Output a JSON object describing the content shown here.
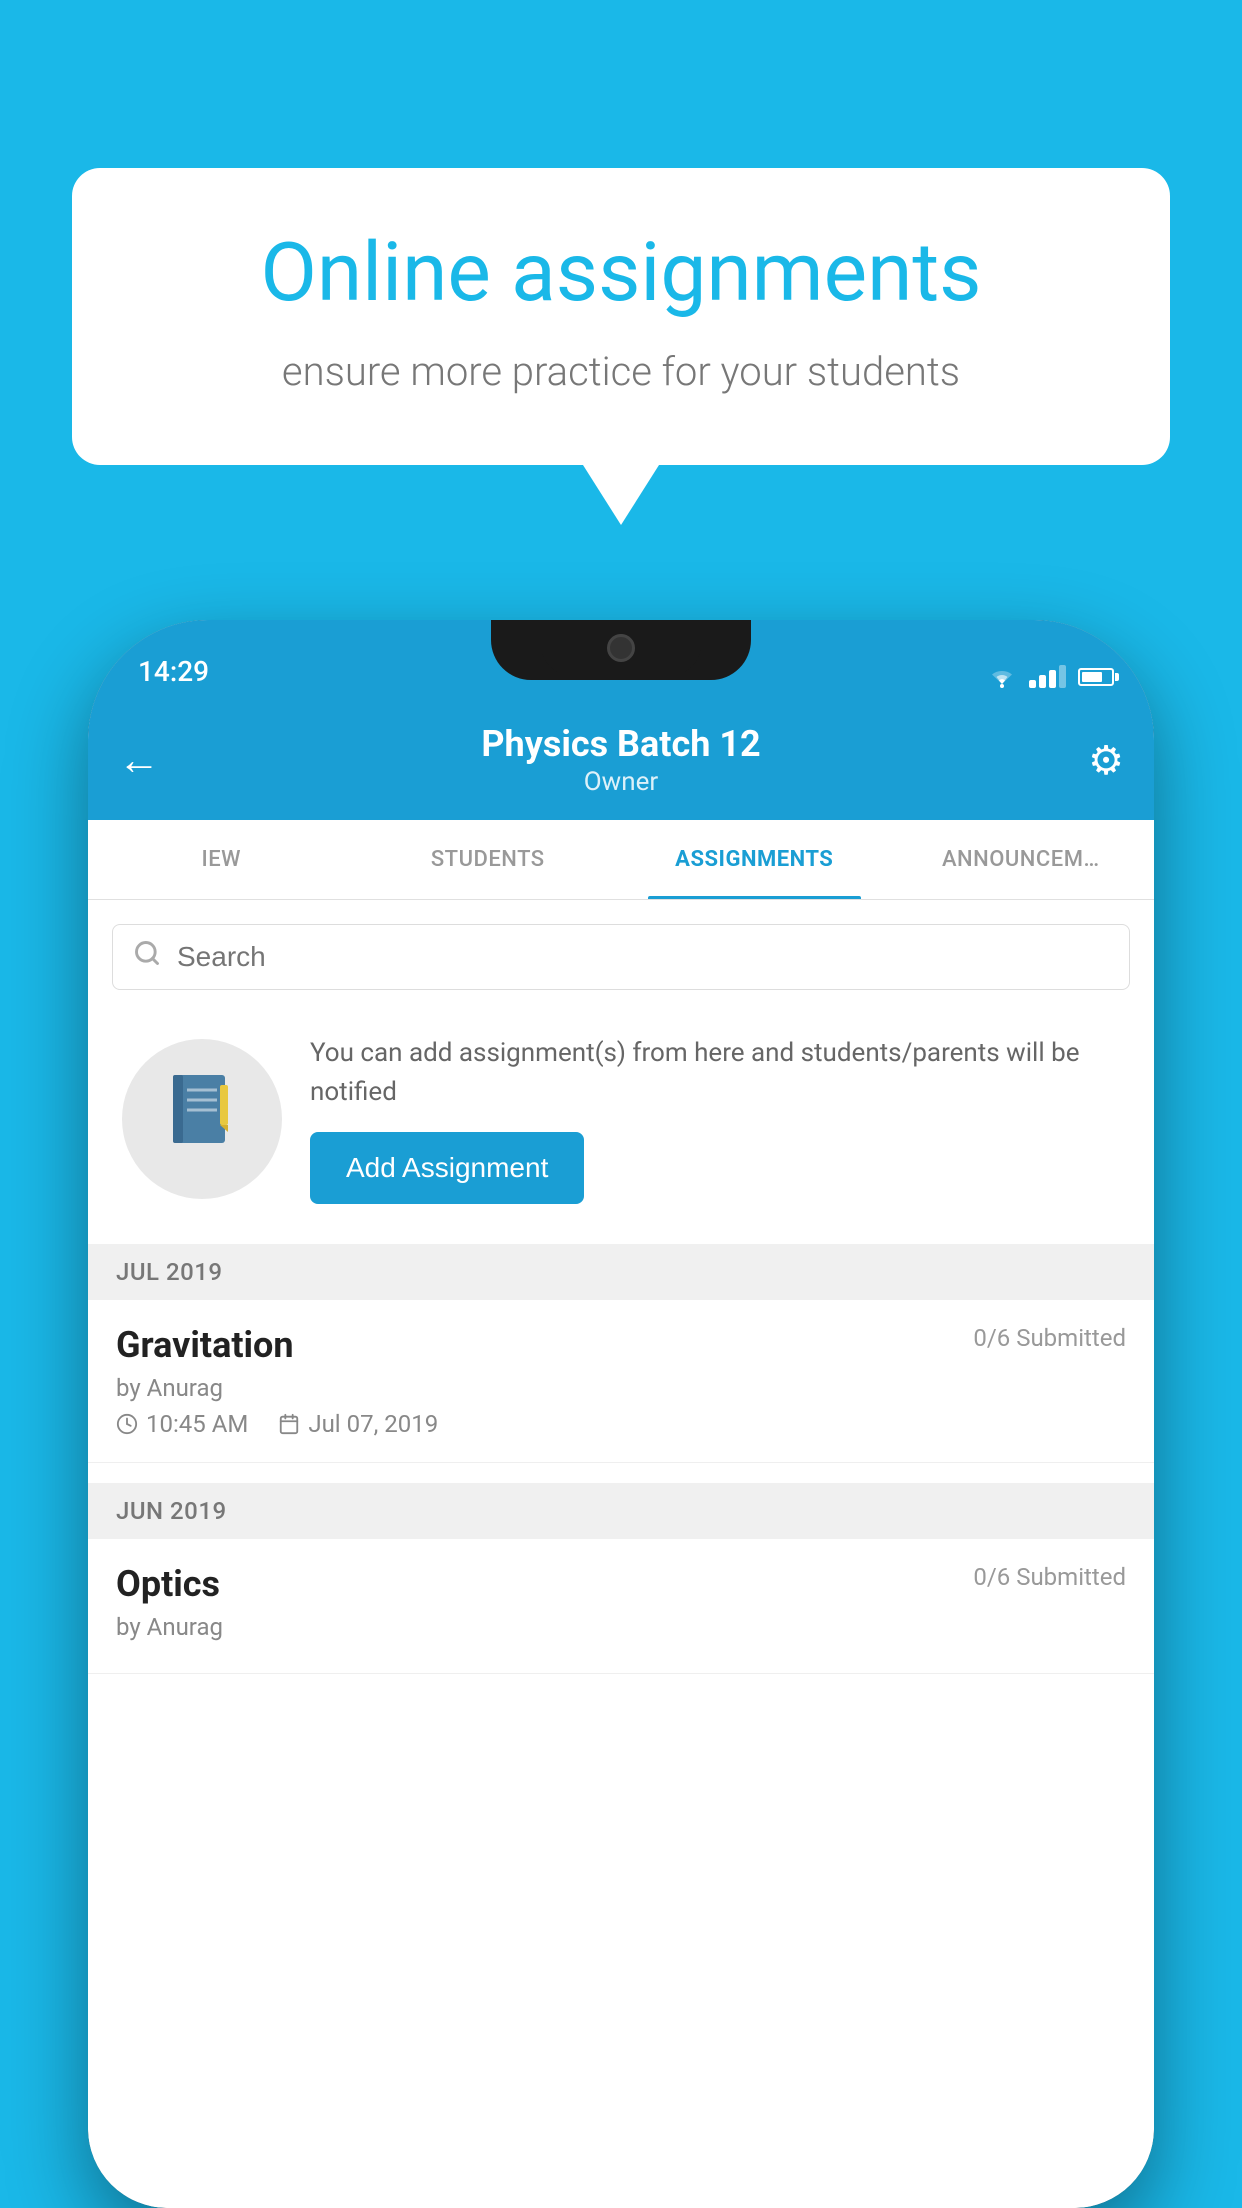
{
  "background_color": "#1ab8e8",
  "speech_bubble": {
    "title": "Online assignments",
    "subtitle": "ensure more practice for your students"
  },
  "status_bar": {
    "time": "14:29"
  },
  "header": {
    "title": "Physics Batch 12",
    "subtitle": "Owner",
    "back_label": "←",
    "settings_label": "⚙"
  },
  "tabs": [
    {
      "label": "IEW",
      "active": false
    },
    {
      "label": "STUDENTS",
      "active": false
    },
    {
      "label": "ASSIGNMENTS",
      "active": true
    },
    {
      "label": "ANNOUNCEM…",
      "active": false
    }
  ],
  "search": {
    "placeholder": "Search"
  },
  "promo": {
    "description": "You can add assignment(s) from here and students/parents will be notified",
    "add_button": "Add Assignment"
  },
  "sections": [
    {
      "label": "JUL 2019",
      "assignments": [
        {
          "title": "Gravitation",
          "submitted": "0/6 Submitted",
          "author": "by Anurag",
          "time": "10:45 AM",
          "date": "Jul 07, 2019"
        }
      ]
    },
    {
      "label": "JUN 2019",
      "assignments": [
        {
          "title": "Optics",
          "submitted": "0/6 Submitted",
          "author": "by Anurag",
          "time": "",
          "date": ""
        }
      ]
    }
  ]
}
